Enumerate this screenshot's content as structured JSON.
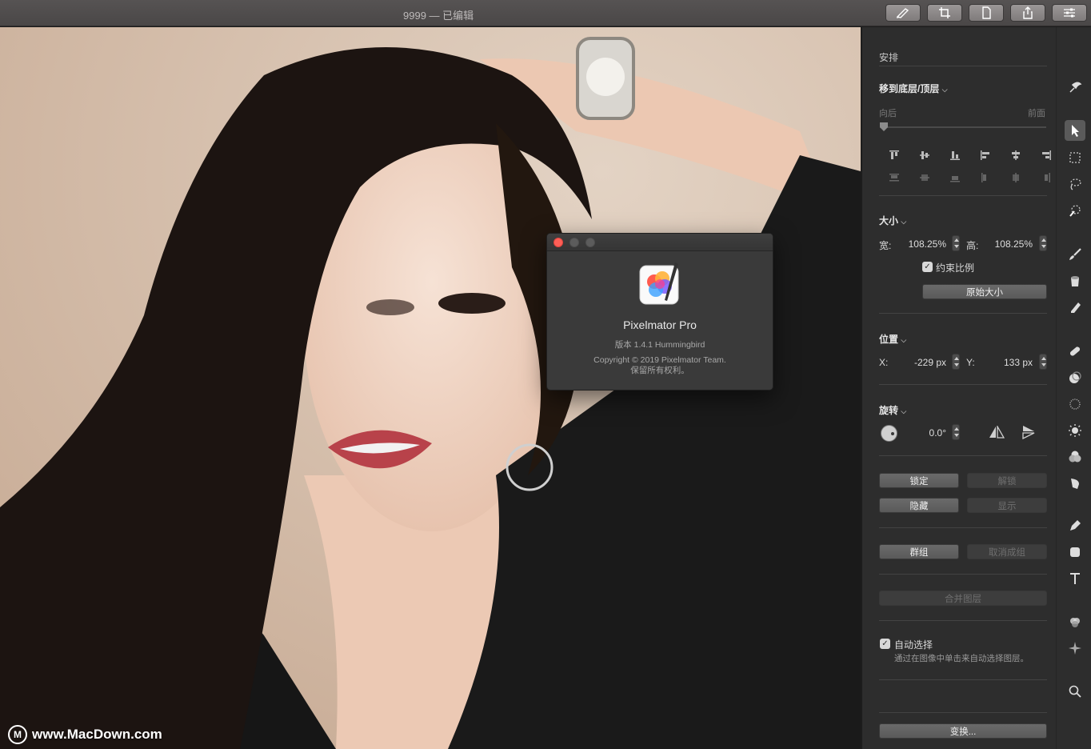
{
  "window": {
    "title": "9999 — 已编辑"
  },
  "toolbar": {
    "buttons": [
      {
        "icon": "brush-stroke-icon"
      },
      {
        "icon": "crop-icon"
      },
      {
        "icon": "document-icon"
      },
      {
        "icon": "share-icon"
      },
      {
        "icon": "sliders-icon"
      }
    ]
  },
  "watermark": {
    "logo": "M",
    "text": "www.MacDown.com"
  },
  "about": {
    "app_name": "Pixelmator Pro",
    "version": "版本 1.4.1 Hummingbird",
    "copyright": "Copyright © 2019 Pixelmator Team.",
    "rights": "保留所有权利。"
  },
  "panel": {
    "arrange": {
      "heading": "安排",
      "order_label": "移到底层/顶层",
      "back_label": "向后",
      "front_label": "前面"
    },
    "size": {
      "heading": "大小",
      "width_label": "宽:",
      "width_value": "108.25%",
      "height_label": "高:",
      "height_value": "108.25%",
      "constrain_label": "约束比例",
      "constrain_checked": true,
      "original_button": "原始大小"
    },
    "position": {
      "heading": "位置",
      "x_label": "X:",
      "x_value": "-229 px",
      "y_label": "Y:",
      "y_value": "133 px"
    },
    "rotation": {
      "heading": "旋转",
      "value": "0.0°"
    },
    "lock_button": "锁定",
    "unlock_button": "解锁",
    "hide_button": "隐藏",
    "show_button": "显示",
    "group_button": "群组",
    "ungroup_button": "取消成组",
    "merge_button": "合并图层",
    "auto_select": {
      "label": "自动选择",
      "checked": true,
      "hint": "通过在图像中单击来自动选择图层。"
    },
    "transform_button": "变换..."
  },
  "tools": [
    "arrange-tool-icon",
    "move-pointer-icon",
    "rectangle-select-icon",
    "lasso-select-icon",
    "magic-select-icon",
    "paint-brush-icon",
    "paint-bucket-icon",
    "eraser-icon",
    "repair-bandage-icon",
    "clone-stamp-icon",
    "blur-icon",
    "light-icon",
    "color-adjust-icon",
    "warp-icon",
    "pen-icon",
    "shape-icon",
    "type-icon",
    "effects-icon",
    "sparkle-icon",
    "zoom-icon"
  ]
}
